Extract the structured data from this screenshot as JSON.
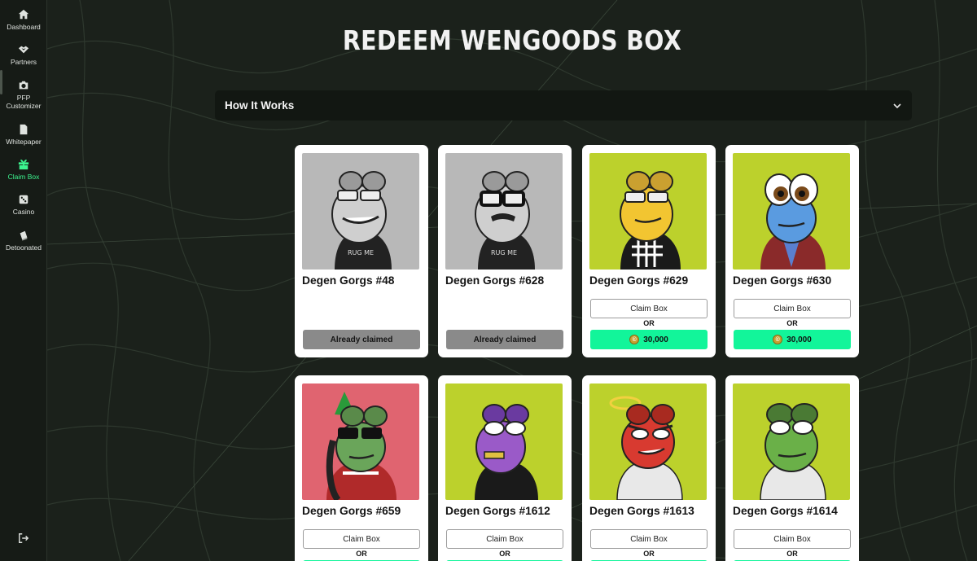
{
  "sidebar": {
    "items": [
      {
        "label": "Dashboard",
        "icon": "home-icon"
      },
      {
        "label": "Partners",
        "icon": "handshake-icon"
      },
      {
        "label": "PFP Customizer",
        "icon": "camera-icon"
      },
      {
        "label": "Whitepaper",
        "icon": "document-icon"
      },
      {
        "label": "Claim Box",
        "icon": "gift-icon",
        "active": true
      },
      {
        "label": "Casino",
        "icon": "dice-icon"
      },
      {
        "label": "Detoonated",
        "icon": "detoonated-icon"
      }
    ],
    "logout_icon": "logout-icon",
    "accent_color": "#3cf58f"
  },
  "page": {
    "title": "REDEEM WENGOODS BOX",
    "how_it_works": "How It Works"
  },
  "cards": [
    {
      "name": "Degen Gorgs #48",
      "bg": "#b8b8b8",
      "status": "claimed",
      "claimed_label": "Already claimed"
    },
    {
      "name": "Degen Gorgs #628",
      "bg": "#b8b8b8",
      "status": "claimed",
      "claimed_label": "Already claimed"
    },
    {
      "name": "Degen Gorgs #629",
      "bg": "#bcd12c",
      "status": "available",
      "claim_label": "Claim Box",
      "or_label": "OR",
      "price": "30,000"
    },
    {
      "name": "Degen Gorgs #630",
      "bg": "#bcd12c",
      "status": "available",
      "claim_label": "Claim Box",
      "or_label": "OR",
      "price": "30,000"
    },
    {
      "name": "Degen Gorgs #659",
      "bg": "#e06470",
      "status": "available",
      "claim_label": "Claim Box",
      "or_label": "OR"
    },
    {
      "name": "Degen Gorgs #1612",
      "bg": "#bcd12c",
      "status": "available",
      "claim_label": "Claim Box",
      "or_label": "OR"
    },
    {
      "name": "Degen Gorgs #1613",
      "bg": "#bcd12c",
      "status": "available",
      "claim_label": "Claim Box",
      "or_label": "OR"
    },
    {
      "name": "Degen Gorgs #1614",
      "bg": "#bcd12c",
      "status": "available",
      "claim_label": "Claim Box",
      "or_label": "OR"
    }
  ],
  "colors": {
    "background": "#1b211b",
    "price_button": "#12f59a",
    "claimed_button": "#8a8a8a"
  }
}
